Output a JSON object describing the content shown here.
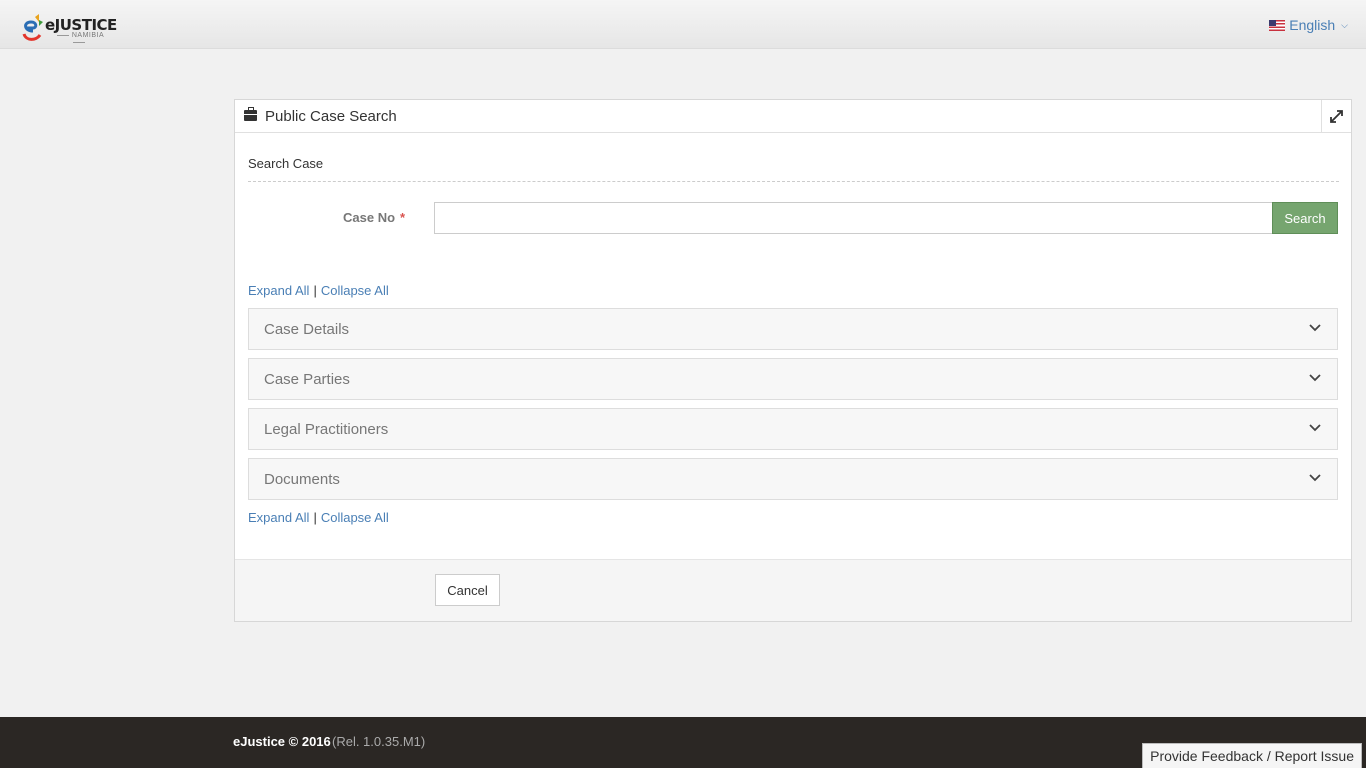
{
  "header": {
    "logo_text": "eJUSTICE",
    "logo_subtext": "NAMIBIA",
    "language": "English"
  },
  "panel": {
    "title": "Public Case Search",
    "section_label": "Search Case",
    "case_no_label": "Case No",
    "required_marker": "*",
    "case_no_value": "",
    "search_label": "Search",
    "expand_all": "Expand All",
    "separator": "|",
    "collapse_all": "Collapse All",
    "accordions": [
      {
        "label": "Case Details"
      },
      {
        "label": "Case Parties"
      },
      {
        "label": "Legal Practitioners"
      },
      {
        "label": "Documents"
      }
    ],
    "cancel_label": "Cancel"
  },
  "footer": {
    "copyright": "eJustice © 2016",
    "release": "(Rel. 1.0.35.M1)",
    "feedback": "Provide Feedback / Report Issue"
  },
  "colors": {
    "link": "#4a7fb5",
    "search_button": "#76a56f",
    "footer_bg": "#2b2724",
    "required": "#d9534f"
  }
}
